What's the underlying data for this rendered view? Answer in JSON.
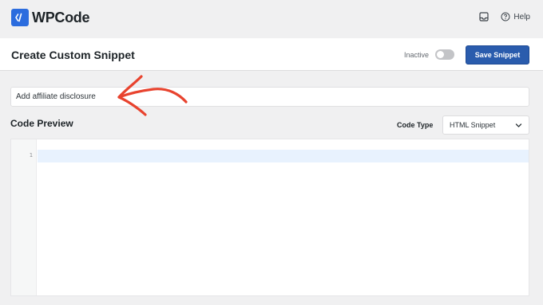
{
  "app": {
    "logo_text": "WPCode",
    "help_label": "Help"
  },
  "header": {
    "title": "Create Custom Snippet",
    "status_label": "Inactive",
    "active": false,
    "save_label": "Save Snippet"
  },
  "snippet": {
    "title_value": "Add affiliate disclosure"
  },
  "code_preview": {
    "label": "Code Preview",
    "code_type_label": "Code Type",
    "code_type_value": "HTML Snippet",
    "line_numbers": [
      "1"
    ]
  },
  "colors": {
    "brand": "#2b6cde",
    "save_button": "#2a5cad",
    "annotation_arrow": "#e8432e"
  },
  "icons": {
    "logo": "code-slash-icon",
    "inbox": "inbox-icon",
    "help": "help-circle-icon",
    "select": "chevron-down-icon",
    "annotation": "hand-drawn-arrow-icon"
  }
}
